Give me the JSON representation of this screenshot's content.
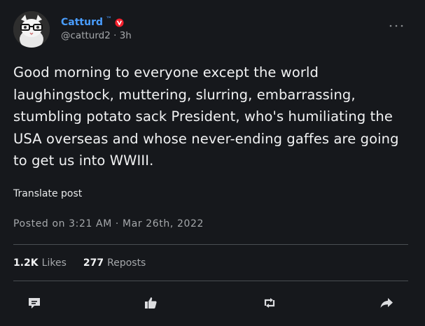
{
  "author": {
    "name": "Catturd",
    "trademark": "™",
    "handle": "@catturd2",
    "time_ago": "3h",
    "avatar_icon": "cat-with-glasses-icon",
    "badge_color": "#f4212e",
    "name_color": "#4a9eff"
  },
  "post": {
    "text": "Good morning to everyone except the world laughingstock, muttering, slurring, embarrassing, stumbling potato sack President, who's humiliating the USA overseas and whose never-ending gaffes are going to get us into WWIII.",
    "translate_label": "Translate post",
    "posted_label": "Posted on 3:21 AM · Mar 26th, 2022"
  },
  "stats": {
    "likes_count": "1.2K",
    "likes_label": "Likes",
    "reposts_count": "277",
    "reposts_label": "Reposts"
  },
  "actions": {
    "reply_icon": "comment-icon",
    "like_icon": "thumbs-up-icon",
    "repost_icon": "repost-icon",
    "share_icon": "share-arrow-icon",
    "more_icon": "more-options-icon"
  }
}
